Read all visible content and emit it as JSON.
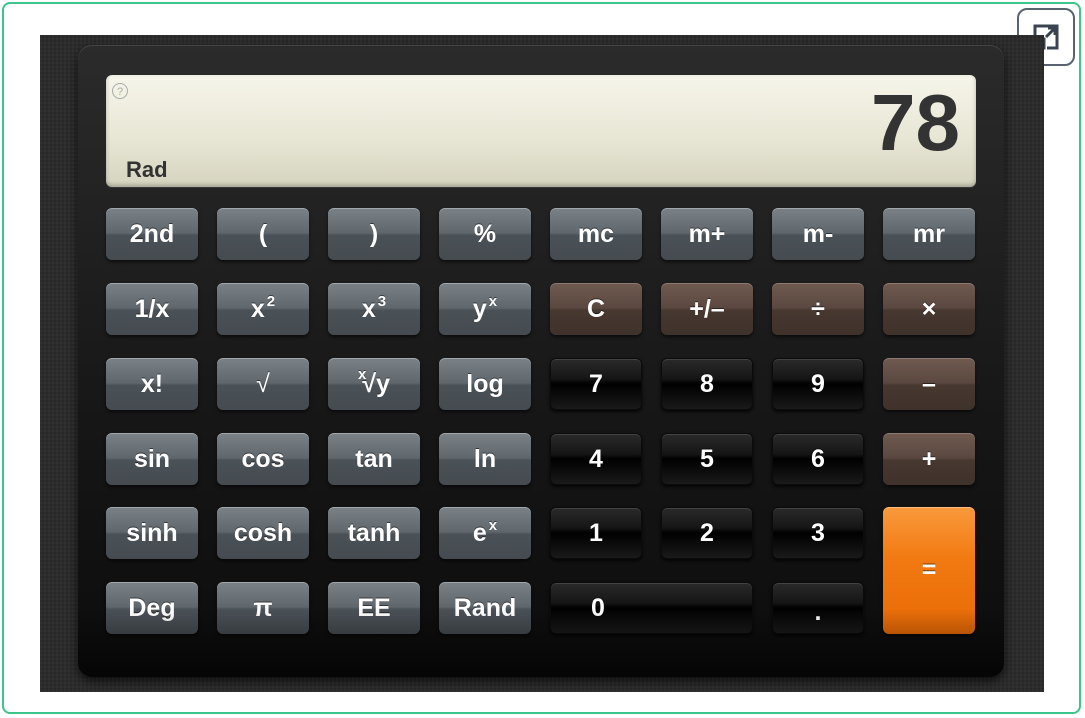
{
  "display": {
    "value": "78",
    "angle_mode": "Rad",
    "help_symbol": "?"
  },
  "buttons": {
    "b2nd": "2nd",
    "lparen": "(",
    "rparen": ")",
    "percent": "%",
    "mc": "mc",
    "mplus": "m+",
    "mminus": "m-",
    "mr": "mr",
    "inv": "1/x",
    "x": "x",
    "sq_exp": "2",
    "cube_exp": "3",
    "y": "y",
    "y_exp": "x",
    "clear": "C",
    "plusminus": "+/–",
    "divide": "÷",
    "multiply": "×",
    "fact": "x!",
    "sqrt": "√",
    "root_index": "x",
    "root_base": "√y",
    "log": "log",
    "d7": "7",
    "d8": "8",
    "d9": "9",
    "minus": "–",
    "sin": "sin",
    "cos": "cos",
    "tan": "tan",
    "ln": "ln",
    "d4": "4",
    "d5": "5",
    "d6": "6",
    "plus": "+",
    "sinh": "sinh",
    "cosh": "cosh",
    "tanh": "tanh",
    "e": "e",
    "e_exp": "x",
    "d1": "1",
    "d2": "2",
    "d3": "3",
    "equals": "=",
    "deg": "Deg",
    "pi": "π",
    "ee": "EE",
    "rand": "Rand",
    "d0": "0",
    "dot": "."
  }
}
